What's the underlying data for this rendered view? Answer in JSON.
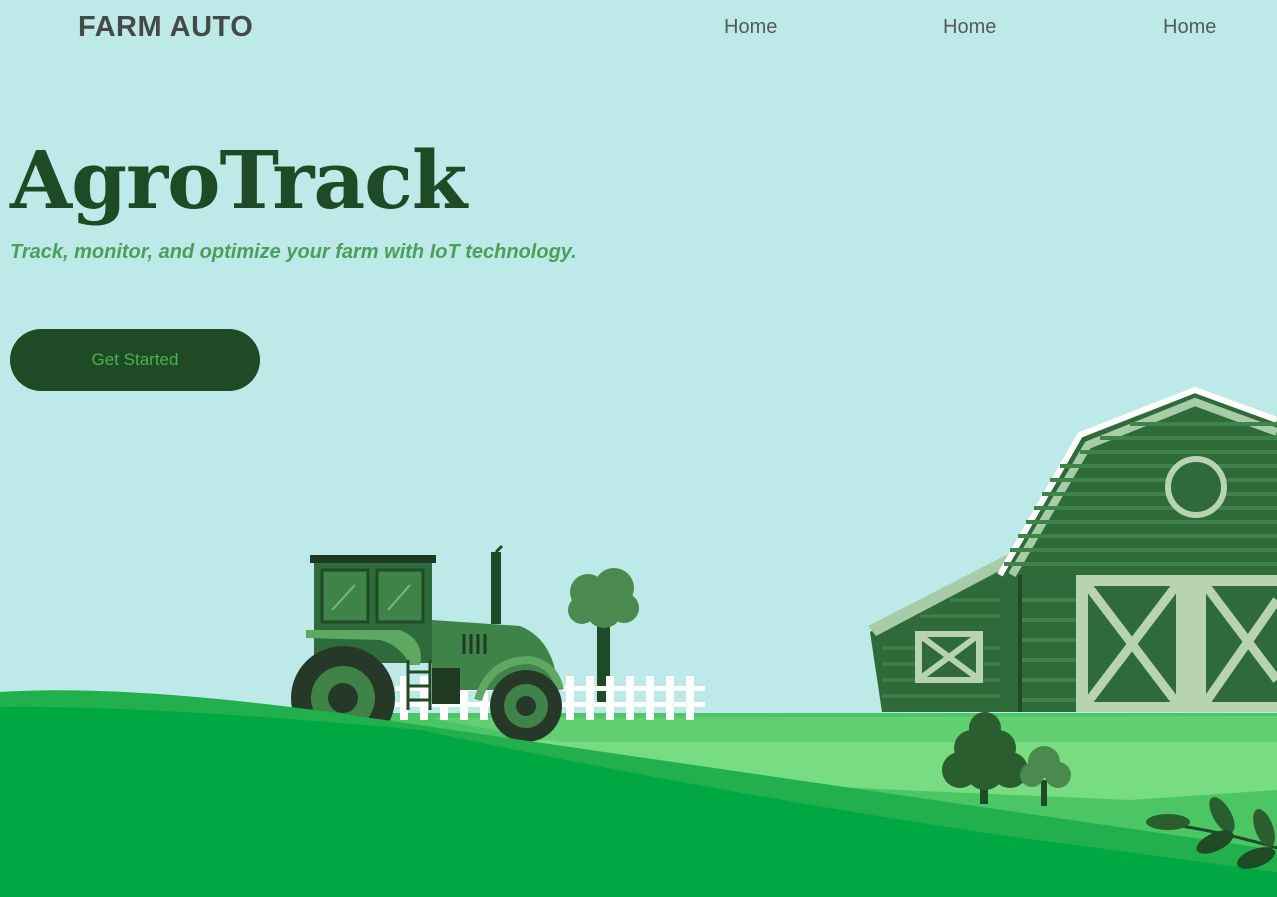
{
  "nav": {
    "brand": "FARM AUTO",
    "links": [
      "Home",
      "Home",
      "Home"
    ]
  },
  "hero": {
    "title": "AgroTrack",
    "tagline": "Track, monitor, and optimize your farm with IoT technology.",
    "cta_label": "Get Started"
  },
  "colors": {
    "background": "#bdeae8",
    "title": "#1f4a26",
    "tagline": "#4aa05a",
    "button_bg": "#1f4a26",
    "button_text": "#4caf50"
  }
}
